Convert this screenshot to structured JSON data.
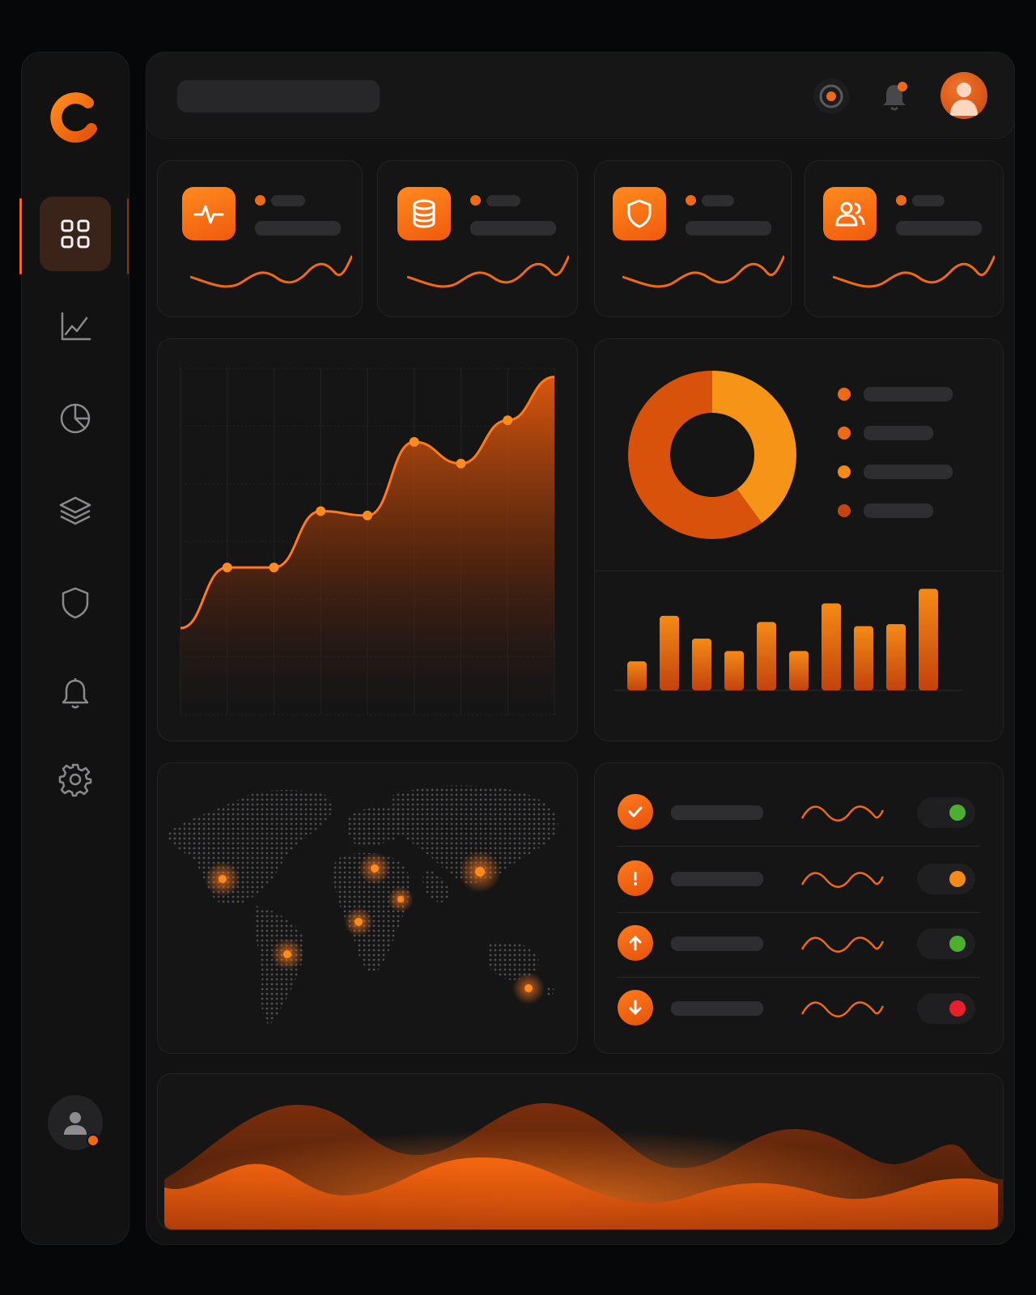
{
  "sidebar": {
    "logo": "logo-c-mark",
    "items": [
      {
        "icon": "grid-icon",
        "active": true
      },
      {
        "icon": "line-chart-icon",
        "active": false
      },
      {
        "icon": "pie-chart-icon",
        "active": false
      },
      {
        "icon": "layers-icon",
        "active": false
      },
      {
        "icon": "shield-icon",
        "active": false
      },
      {
        "icon": "bell-icon",
        "active": false
      },
      {
        "icon": "gear-icon",
        "active": false
      }
    ],
    "user_icon": "user-icon"
  },
  "topbar": {
    "search_placeholder": "",
    "icons": [
      "target-icon",
      "bell-icon",
      "avatar"
    ]
  },
  "stat_cards": [
    {
      "icon": "pulse-icon"
    },
    {
      "icon": "database-icon"
    },
    {
      "icon": "shield-icon"
    },
    {
      "icon": "users-icon"
    }
  ],
  "status_list": [
    {
      "icon": "check-icon",
      "status": "green"
    },
    {
      "icon": "exclamation-icon",
      "status": "orange"
    },
    {
      "icon": "arrow-up-icon",
      "status": "green"
    },
    {
      "icon": "arrow-down-icon",
      "status": "red"
    }
  ],
  "colors": {
    "accent": "#f06a16",
    "accent_light": "#ff8a1e",
    "background": "#060708",
    "panel": "#121213",
    "green": "#4caf30",
    "red": "#e8202a"
  },
  "chart_data": [
    {
      "type": "area",
      "title": "",
      "x": [
        1,
        2,
        3,
        4,
        5,
        6,
        7,
        8,
        9
      ],
      "values": [
        20,
        34,
        34,
        47,
        46,
        63,
        58,
        68,
        78
      ],
      "ylim": [
        0,
        80
      ],
      "grid": true
    },
    {
      "type": "pie",
      "donut": true,
      "values": [
        40,
        60
      ]
    },
    {
      "type": "bar",
      "values": [
        28,
        72,
        50,
        38,
        66,
        38,
        84,
        62,
        64,
        98
      ],
      "ylim": [
        0,
        100
      ]
    }
  ],
  "map": {
    "hotspots": [
      "north-america",
      "europe",
      "east-asia",
      "middle-east",
      "africa",
      "south-america",
      "australia"
    ]
  }
}
